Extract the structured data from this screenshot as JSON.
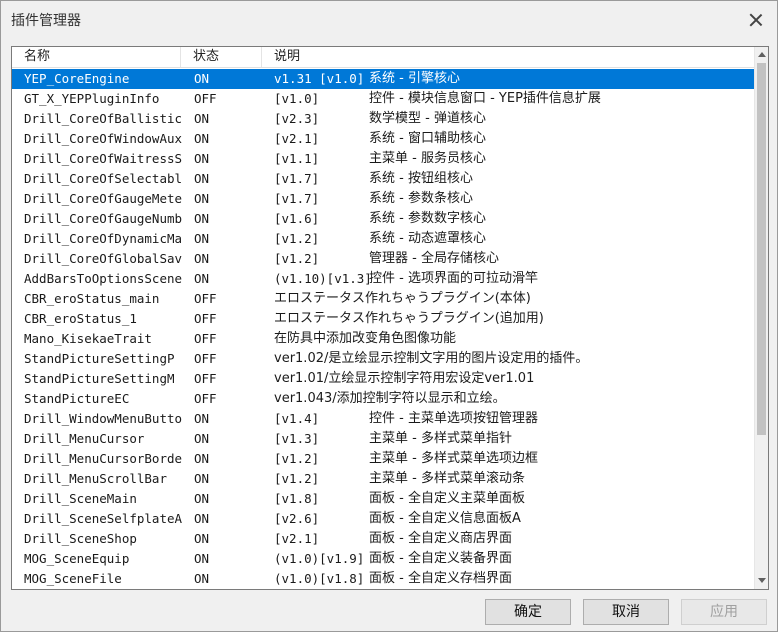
{
  "window": {
    "title": "插件管理器"
  },
  "columns": {
    "name": "名称",
    "status": "状态",
    "desc": "说明"
  },
  "rows": [
    {
      "name": "YEP_CoreEngine",
      "status": "ON",
      "ver": "v1.31 [v1.0]",
      "desc": "系统 - 引擎核心",
      "selected": true
    },
    {
      "name": "GT_X_YEPPluginInfo",
      "status": "OFF",
      "ver": "[v1.0]",
      "desc": "控件 - 模块信息窗口 - YEP插件信息扩展"
    },
    {
      "name": "Drill_CoreOfBallistics",
      "status": "ON",
      "ver": "[v2.3]",
      "desc": "数学模型 - 弹道核心"
    },
    {
      "name": "Drill_CoreOfWindowAux…",
      "status": "ON",
      "ver": "[v2.1]",
      "desc": "系统 - 窗口辅助核心"
    },
    {
      "name": "Drill_CoreOfWaitressS…",
      "status": "ON",
      "ver": "[v1.1]",
      "desc": "主菜单 - 服务员核心"
    },
    {
      "name": "Drill_CoreOfSelectabl…",
      "status": "ON",
      "ver": "[v1.7]",
      "desc": "系统 - 按钮组核心"
    },
    {
      "name": "Drill_CoreOfGaugeMeter",
      "status": "ON",
      "ver": "[v1.7]",
      "desc": "系统 - 参数条核心"
    },
    {
      "name": "Drill_CoreOfGaugeNumber",
      "status": "ON",
      "ver": "[v1.6]",
      "desc": "系统 - 参数数字核心"
    },
    {
      "name": "Drill_CoreOfDynamicMask",
      "status": "ON",
      "ver": "[v1.2]",
      "desc": "系统 - 动态遮罩核心"
    },
    {
      "name": "Drill_CoreOfGlobalSave",
      "status": "ON",
      "ver": "[v1.2]",
      "desc": "管理器 - 全局存储核心"
    },
    {
      "name": "AddBarsToOptionsScene",
      "status": "ON",
      "ver": "(v1.10)[v1.3]",
      "desc": "控件 - 选项界面的可拉动滑竿"
    },
    {
      "name": "CBR_eroStatus_main",
      "status": "OFF",
      "full": "エロステータス作れちゃうプラグイン(本体)"
    },
    {
      "name": "CBR_eroStatus_1",
      "status": "OFF",
      "full": "エロステータス作れちゃうプラグイン(追加用)"
    },
    {
      "name": "Mano_KisekaeTrait",
      "status": "OFF",
      "full": "在防具中添加改变角色图像功能"
    },
    {
      "name": "StandPictureSettingP",
      "status": "OFF",
      "full": "ver1.02/是立绘显示控制文字用的图片设定用的插件。"
    },
    {
      "name": "StandPictureSettingM",
      "status": "OFF",
      "full": "ver1.01/立绘显示控制字符用宏设定ver1.01"
    },
    {
      "name": "StandPictureEC",
      "status": "OFF",
      "full": "ver1.043/添加控制字符以显示和立绘。"
    },
    {
      "name": "Drill_WindowMenuButton",
      "status": "ON",
      "ver": "[v1.4]",
      "desc": "控件 - 主菜单选项按钮管理器"
    },
    {
      "name": "Drill_MenuCursor",
      "status": "ON",
      "ver": "[v1.3]",
      "desc": "主菜单 - 多样式菜单指针"
    },
    {
      "name": "Drill_MenuCursorBorder",
      "status": "ON",
      "ver": "[v1.2]",
      "desc": "主菜单 - 多样式菜单选项边框"
    },
    {
      "name": "Drill_MenuScrollBar",
      "status": "ON",
      "ver": "[v1.2]",
      "desc": "主菜单 - 多样式菜单滚动条"
    },
    {
      "name": "Drill_SceneMain",
      "status": "ON",
      "ver": "[v1.8]",
      "desc": "面板 - 全自定义主菜单面板"
    },
    {
      "name": "Drill_SceneSelfplateA",
      "status": "ON",
      "ver": "[v2.6]",
      "desc": "面板 - 全自定义信息面板A"
    },
    {
      "name": "Drill_SceneShop",
      "status": "ON",
      "ver": "[v2.1]",
      "desc": "面板 - 全自定义商店界面"
    },
    {
      "name": "MOG_SceneEquip",
      "status": "ON",
      "ver": "(v1.0)[v1.9]",
      "desc": "面板 - 全自定义装备界面"
    },
    {
      "name": "MOG_SceneFile",
      "status": "ON",
      "ver": "(v1.0)[v1.8]",
      "desc": "面板 - 全自定义存档界面"
    }
  ],
  "buttons": {
    "ok": "确定",
    "cancel": "取消",
    "apply": "应用"
  },
  "colors": {
    "selection": "#0078d7",
    "background": "#f0f0f0",
    "list_background": "#ffffff"
  }
}
